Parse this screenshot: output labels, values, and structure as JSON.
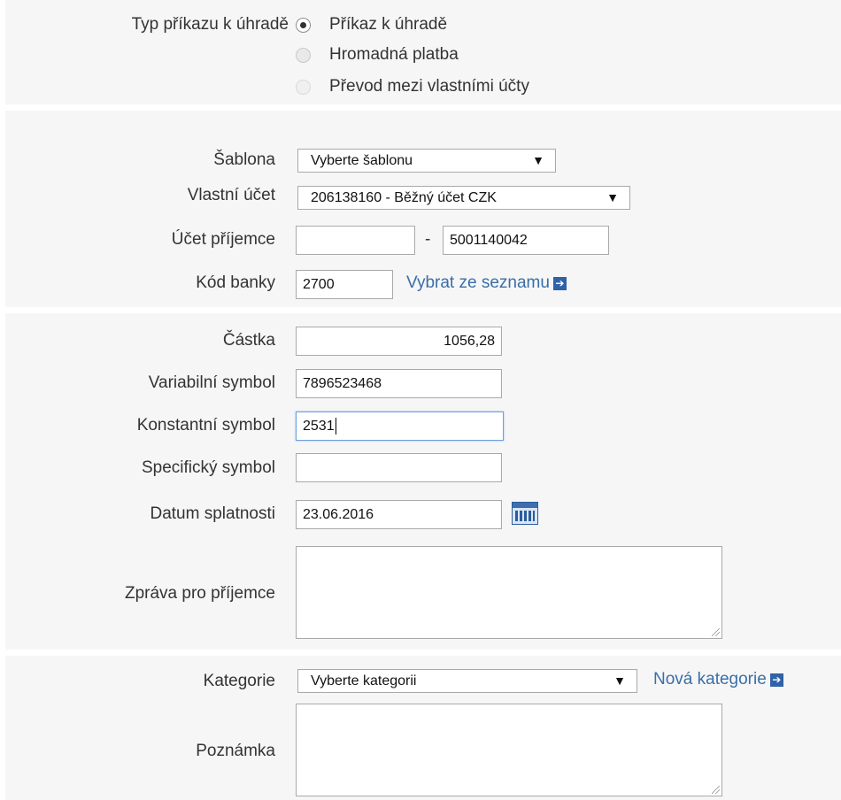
{
  "payment_type": {
    "label": "Typ příkazu k úhradě",
    "options": [
      {
        "label": "Příkaz k úhradě",
        "selected": true,
        "disabled": false
      },
      {
        "label": "Hromadná platba",
        "selected": false,
        "disabled": false
      },
      {
        "label": "Převod mezi vlastními účty",
        "selected": false,
        "disabled": true
      }
    ]
  },
  "account": {
    "template_label": "Šablona",
    "template_value": "Vyberte šablonu",
    "own_account_label": "Vlastní účet",
    "own_account_value": "206138160 - Běžný účet CZK",
    "recipient_label": "Účet příjemce",
    "recipient_prefix": "",
    "recipient_separator": "-",
    "recipient_number": "5001140042",
    "bank_code_label": "Kód banky",
    "bank_code_value": "2700",
    "choose_from_list": "Vybrat ze seznamu"
  },
  "details": {
    "amount_label": "Částka",
    "amount_value": "1056,28",
    "variable_symbol_label": "Variabilní symbol",
    "variable_symbol_value": "7896523468",
    "constant_symbol_label": "Konstantní symbol",
    "constant_symbol_value": "2531",
    "specific_symbol_label": "Specifický symbol",
    "specific_symbol_value": "",
    "due_date_label": "Datum splatnosti",
    "due_date_value": "23.06.2016",
    "message_label": "Zpráva pro příjemce",
    "message_value": ""
  },
  "category": {
    "label": "Kategorie",
    "value": "Vyberte kategorii",
    "new_category": "Nová kategorie",
    "note_label": "Poznámka",
    "note_value": ""
  },
  "icons": {
    "dropdown": "triangle-down-icon",
    "link_arrow": "arrow-right-box-icon",
    "calendar": "calendar-icon"
  },
  "colors": {
    "band_background": "#f6f6f6",
    "link": "#3a6ea8",
    "focus_border": "#6d9fdb"
  }
}
